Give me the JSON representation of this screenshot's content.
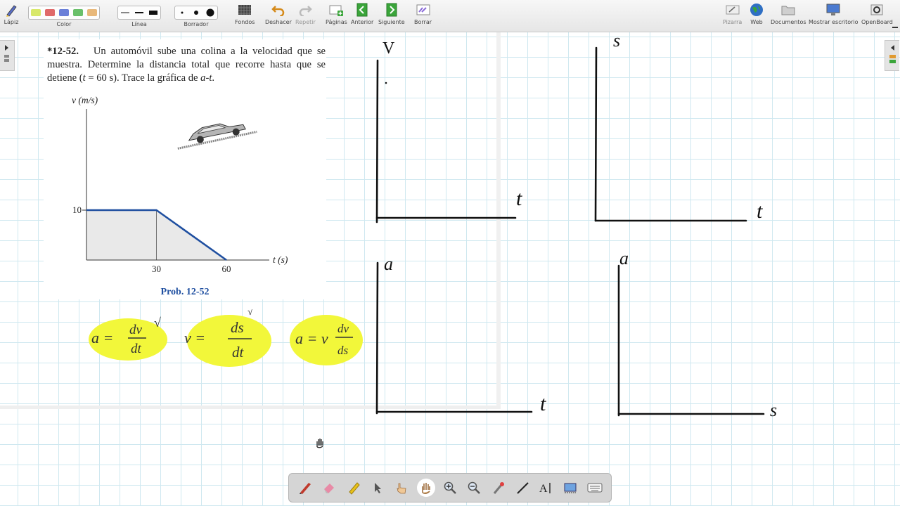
{
  "toolbar": {
    "lapiz": "Lápiz",
    "color": "Color",
    "linea": "Línea",
    "borrador": "Borrador",
    "fondos": "Fondos",
    "deshacer": "Deshacer",
    "repetir": "Repetir",
    "paginas": "Páginas",
    "anterior": "Anterior",
    "siguiente": "Siguiente",
    "borrar": "Borrar",
    "pizarra": "Pizarra",
    "web": "Web",
    "documentos": "Documentos",
    "mostrar_escritorio": "Mostrar escritorio",
    "openboard": "OpenBoard",
    "colors": [
      "#d8e86a",
      "#e06a6a",
      "#6a7fd8",
      "#6ac06a",
      "#e8b87a"
    ]
  },
  "problem": {
    "number": "*12-52.",
    "text_1": "Un automóvil sube una colina a la velocidad que se muestra. Determine la distancia total que recorre hasta que se detiene (",
    "t_var": "t",
    "text_2": " = 60 s). Trace la gráfica de ",
    "at_var": "a-t",
    "text_3": ".",
    "caption": "Prob. 12-52"
  },
  "chart_data": {
    "type": "line",
    "ylabel": "v (m/s)",
    "xlabel": "t (s)",
    "x": [
      0,
      30,
      60
    ],
    "y": [
      10,
      10,
      0
    ],
    "xticks": [
      "30",
      "60"
    ],
    "yticks": [
      "10"
    ],
    "xlim": [
      0,
      60
    ],
    "ylim": [
      0,
      10
    ],
    "area_fill": true,
    "color": "#1f4fa0"
  },
  "formulas": {
    "f1_lhs": "a =",
    "f1_num": "dv",
    "f1_den": "dt",
    "f1_mark": "√",
    "f2_lhs": "v =",
    "f2_num": "ds",
    "f2_den": "dt",
    "f2_mark": "√",
    "f3_lhs": "a = v",
    "f3_num": "dv",
    "f3_den": "ds",
    "highlight": "#f2f73a"
  },
  "axes_sketches": {
    "g1_y": "V",
    "g1_x": "t",
    "g2_y": "s",
    "g2_x": "t",
    "g3_y": "a",
    "g3_x": "t",
    "g4_y": "a",
    "g4_x": "s"
  }
}
